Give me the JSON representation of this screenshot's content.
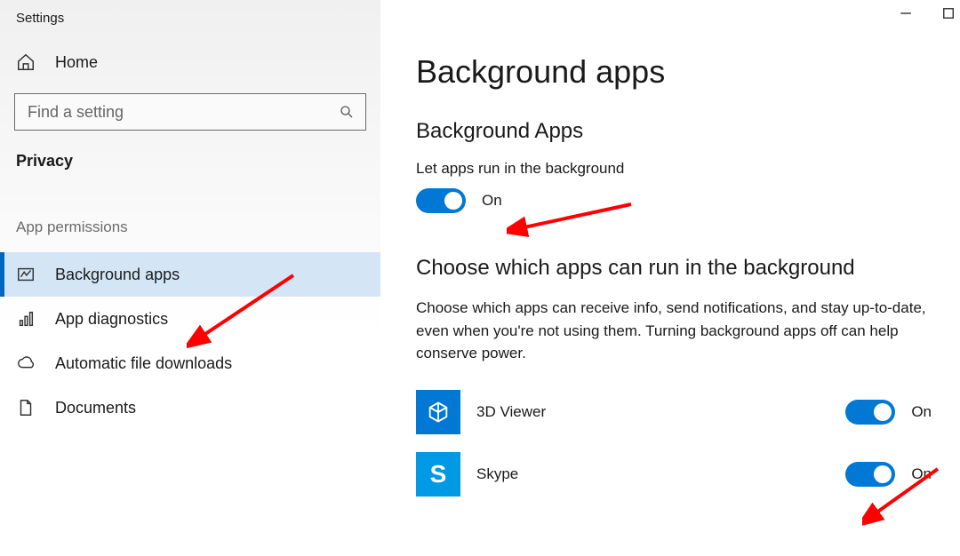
{
  "window_title": "Settings",
  "home_label": "Home",
  "search_placeholder": "Find a setting",
  "section_label": "Privacy",
  "subsection_label": "App permissions",
  "nav_items": [
    {
      "label": "Background apps",
      "active": true
    },
    {
      "label": "App diagnostics",
      "active": false
    },
    {
      "label": "Automatic file downloads",
      "active": false
    },
    {
      "label": "Documents",
      "active": false
    }
  ],
  "main": {
    "page_title": "Background apps",
    "master_section_title": "Background Apps",
    "master_toggle_label": "Let apps run in the background",
    "master_toggle_state": "On",
    "choose_title": "Choose which apps can run in the background",
    "choose_desc": "Choose which apps can receive info, send notifications, and stay up-to-date, even when you're not using them. Turning background apps off can help conserve power.",
    "apps": [
      {
        "name": "3D Viewer",
        "state": "On"
      },
      {
        "name": "Skype",
        "state": "On"
      }
    ]
  },
  "colors": {
    "accent": "#0078d4",
    "sidebar_active_bg": "#d4e6f6",
    "annotation_red": "#ff0000"
  }
}
